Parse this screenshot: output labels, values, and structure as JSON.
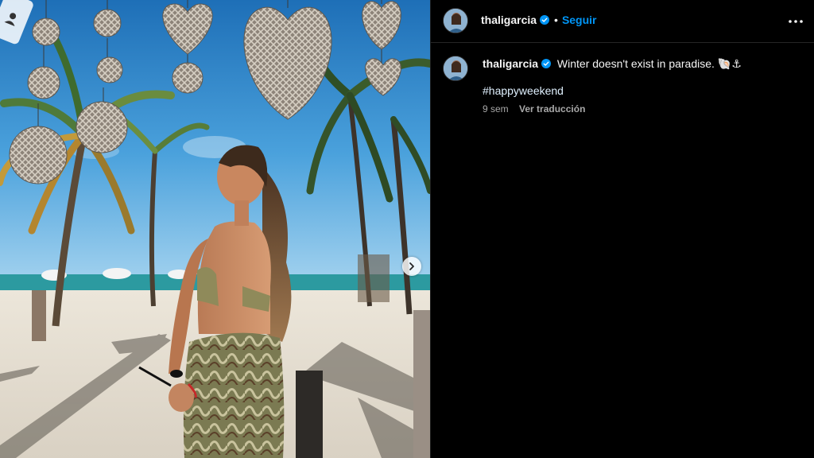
{
  "post": {
    "username": "thaligarcia",
    "follow_label": "Seguir",
    "separator": "•",
    "caption": "Winter doesn't exist in paradise. 🐚⚓",
    "hashtag": "#happyweekend",
    "time_ago": "9 sem",
    "translate_label": "Ver traducción"
  },
  "icons": {
    "verified": "verified-badge-icon",
    "more": "more-options-icon",
    "next": "chevron-right-icon"
  },
  "colors": {
    "accent": "#0095f6",
    "background": "#000000",
    "text": "#f5f5f5",
    "muted": "#a8a8a8",
    "divider": "#262626"
  }
}
